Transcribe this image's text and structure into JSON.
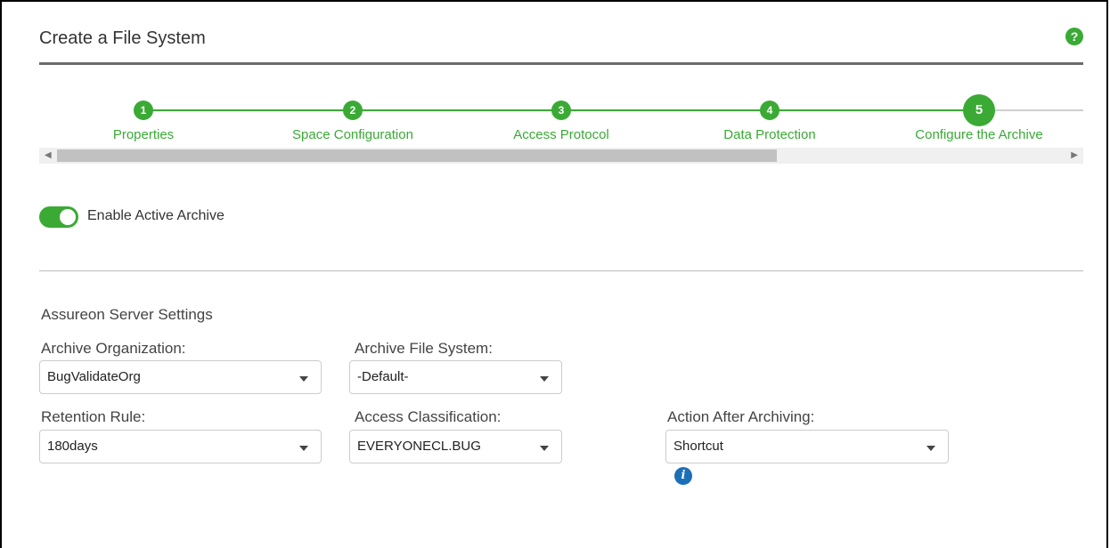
{
  "header": {
    "title": "Create a File System",
    "help_icon": "?"
  },
  "wizard": {
    "steps": [
      {
        "number": "1",
        "label": "Properties"
      },
      {
        "number": "2",
        "label": "Space Configuration"
      },
      {
        "number": "3",
        "label": "Access Protocol"
      },
      {
        "number": "4",
        "label": "Data Protection"
      },
      {
        "number": "5",
        "label": "Configure the Archive"
      }
    ],
    "current_step": "5"
  },
  "archive": {
    "toggle_label": "Enable Active Archive",
    "enabled": true
  },
  "server_settings": {
    "title": "Assureon Server Settings",
    "archive_organization": {
      "label": "Archive Organization:",
      "value": "BugValidateOrg"
    },
    "archive_file_system": {
      "label": "Archive File System:",
      "value": "-Default-"
    },
    "retention_rule": {
      "label": "Retention Rule:",
      "value": "180days"
    },
    "access_classification": {
      "label": "Access Classification:",
      "value": "EVERYONECL.BUG"
    },
    "action_after_archiving": {
      "label": "Action After Archiving:",
      "value": "Shortcut"
    }
  },
  "colors": {
    "accent": "#3aaa35",
    "info": "#1c6fb6"
  }
}
